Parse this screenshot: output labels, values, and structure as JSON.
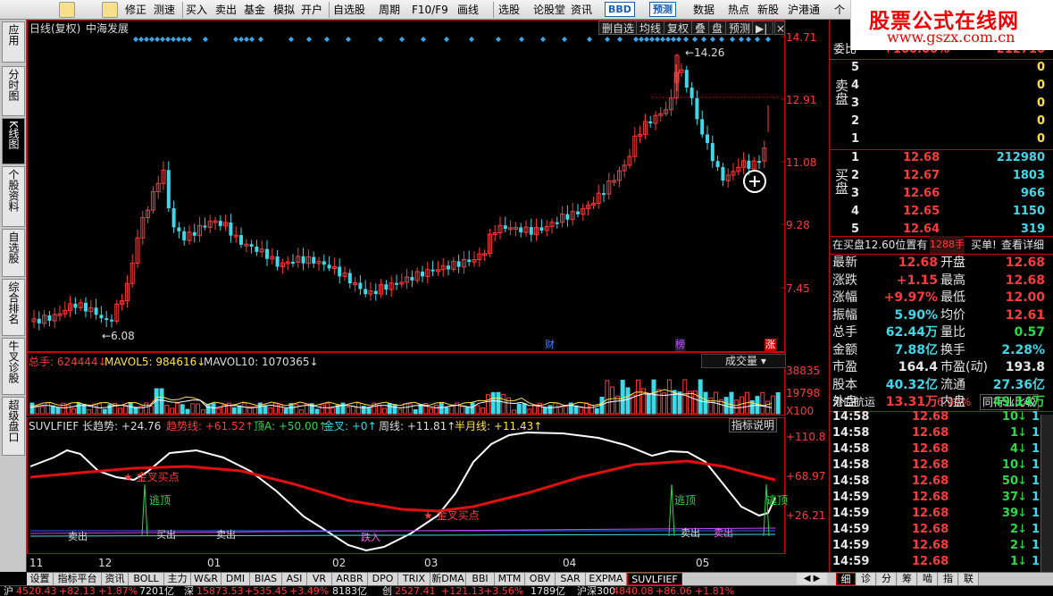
{
  "toolbar": {
    "items": [
      "修正",
      "测速",
      "买入",
      "卖出",
      "基金",
      "模拟",
      "开户",
      "自选股",
      "周期",
      "F10/F9",
      "画线",
      "选股",
      "论股堂",
      "资讯",
      "BBD",
      "预测",
      "数据",
      "热点",
      "新股",
      "沪港通",
      "个"
    ]
  },
  "brand": {
    "title": "股票公式在线网",
    "url": "www.gszx.com.cn"
  },
  "leftnav": [
    "应用",
    "分时图",
    "K线图",
    "个股资料",
    "自选股",
    "综合排名",
    "牛叉诊股",
    "超级盘口"
  ],
  "chart": {
    "header_left": "日线(复权)",
    "stock_name": "中海发展",
    "tools": [
      "删自选",
      "均线",
      "复权",
      "叠",
      "盘",
      "预测"
    ],
    "price_axis": [
      "14.71",
      "12.91",
      "11.08",
      "9.28",
      "7.45"
    ],
    "high_label": "14.26",
    "low_label": "6.08",
    "event_markers": [
      "财",
      "榜",
      "涨"
    ],
    "volume_header": {
      "total": "总手: 624444",
      "mavol5": "MAVOL5: 984616",
      "mavol10": "MAVOL10: 1070365"
    },
    "volume_selector": "成交量",
    "volume_axis": [
      "38835",
      "19798",
      "X100"
    ],
    "indicator_header": {
      "name": "SUVLFIEF 长趋势: +24.76",
      "trend": "趋势线: +61.52",
      "topa": "顶A: +50.00",
      "cross": "金叉: +0",
      "week": "周线: +11.81",
      "halfmonth": "半月线: +11.43"
    },
    "indicator_explain": "指标说明",
    "indicator_axis": [
      "+110.8",
      "+68.97",
      "+26.21"
    ],
    "annotations": [
      "金叉买点",
      "金叉买点",
      "逃顶",
      "逃顶",
      "逃顶",
      "卖出",
      "买出",
      "卖出",
      "跌入",
      "卖出",
      "卖出"
    ],
    "month_axis": [
      "11",
      "12",
      "01",
      "02",
      "03",
      "04",
      "05"
    ]
  },
  "colors": {
    "up": "#ff3b3b",
    "down": "#3fd8e8",
    "bg": "#000000",
    "frame": "#cc0000"
  },
  "right": {
    "wei": {
      "label": "委比",
      "value": "+100.00%",
      "diff": "212710"
    },
    "sell_label": "卖盘",
    "buy_label": "买盘",
    "sell": [
      {
        "lvl": "5",
        "price": "",
        "vol": "0"
      },
      {
        "lvl": "4",
        "price": "",
        "vol": "0"
      },
      {
        "lvl": "3",
        "price": "",
        "vol": "0"
      },
      {
        "lvl": "2",
        "price": "",
        "vol": "0"
      },
      {
        "lvl": "1",
        "price": "",
        "vol": "0"
      }
    ],
    "buy": [
      {
        "lvl": "1",
        "price": "12.68",
        "vol": "212980"
      },
      {
        "lvl": "2",
        "price": "12.67",
        "vol": "1803"
      },
      {
        "lvl": "3",
        "price": "12.66",
        "vol": "966"
      },
      {
        "lvl": "4",
        "price": "12.65",
        "vol": "1150"
      },
      {
        "lvl": "5",
        "price": "12.64",
        "vol": "319"
      }
    ],
    "notice": {
      "text": "在买盘12.60位置有",
      "qty": "1288手",
      "action": "买单!",
      "link": "查看详细"
    },
    "stats": [
      {
        "k1": "最新",
        "v1": "12.68",
        "k2": "开盘",
        "v2": "12.68",
        "c1": "red",
        "c2": "red"
      },
      {
        "k1": "涨跌",
        "v1": "+1.15",
        "k2": "最高",
        "v2": "12.68",
        "c1": "red",
        "c2": "red"
      },
      {
        "k1": "涨幅",
        "v1": "+9.97%",
        "k2": "最低",
        "v2": "12.00",
        "c1": "red",
        "c2": "red"
      },
      {
        "k1": "振幅",
        "v1": "5.90%",
        "k2": "均价",
        "v2": "12.61",
        "c1": "cya",
        "c2": "red"
      },
      {
        "k1": "总手",
        "v1": "62.44万",
        "k2": "量比",
        "v2": "0.57",
        "c1": "cya",
        "c2": "grn"
      },
      {
        "k1": "金额",
        "v1": "7.88亿",
        "k2": "换手",
        "v2": "2.28%",
        "c1": "cya",
        "c2": "cya"
      },
      {
        "k1": "市盈",
        "v1": "164.4",
        "k2": "市盈(动)",
        "v2": "193.8",
        "c1": "wht",
        "c2": "wht"
      },
      {
        "k1": "股本",
        "v1": "40.32亿",
        "k2": "流通",
        "v2": "27.36亿",
        "c1": "cya",
        "c2": "cya"
      },
      {
        "k1": "外盘",
        "v1": "13.31万",
        "k2": "内盘",
        "v2": "49.14万",
        "c1": "red",
        "c2": "grn"
      }
    ],
    "sector": {
      "name": "港口航运",
      "pct": "6.06%",
      "compare": "同行业比较"
    },
    "ticks": [
      {
        "t": "14:58",
        "p": "12.68",
        "v": "10",
        "n": "1"
      },
      {
        "t": "14:58",
        "p": "12.68",
        "v": "1",
        "n": "1"
      },
      {
        "t": "14:58",
        "p": "12.68",
        "v": "4",
        "n": "1"
      },
      {
        "t": "14:58",
        "p": "12.68",
        "v": "10",
        "n": "1"
      },
      {
        "t": "14:58",
        "p": "12.68",
        "v": "50",
        "n": "1"
      },
      {
        "t": "14:59",
        "p": "12.68",
        "v": "37",
        "n": "1"
      },
      {
        "t": "14:59",
        "p": "12.68",
        "v": "39",
        "n": "1"
      },
      {
        "t": "14:59",
        "p": "12.68",
        "v": "2",
        "n": "1"
      },
      {
        "t": "14:59",
        "p": "12.68",
        "v": "2",
        "n": "1"
      },
      {
        "t": "14:59",
        "p": "12.68",
        "v": "1",
        "n": "1"
      }
    ],
    "bottom_tabs": [
      "细",
      "诊",
      "分",
      "筹",
      "啮",
      "指",
      "联"
    ]
  },
  "bottom_tabs": [
    "设置",
    "指标平台",
    "资讯",
    "BOLL",
    "主力",
    "W&R",
    "DMI",
    "BIAS",
    "ASI",
    "VR",
    "ARBR",
    "DPO",
    "TRIX",
    "新DMA",
    "BBI",
    "MTM",
    "OBV",
    "SAR",
    "EXPMA",
    "SUVLFIEF"
  ],
  "status": {
    "items": [
      "沪",
      "4520.43",
      "+82.13",
      "+1.87%",
      "7201亿",
      "深",
      "15873.53",
      "+535.45",
      "+3.49%",
      "8183亿",
      "创",
      "2527.41",
      "+121.13",
      "+3.56%",
      "1789亿",
      "沪深300",
      "4840.08",
      "+86.06",
      "+1.81%"
    ]
  }
}
